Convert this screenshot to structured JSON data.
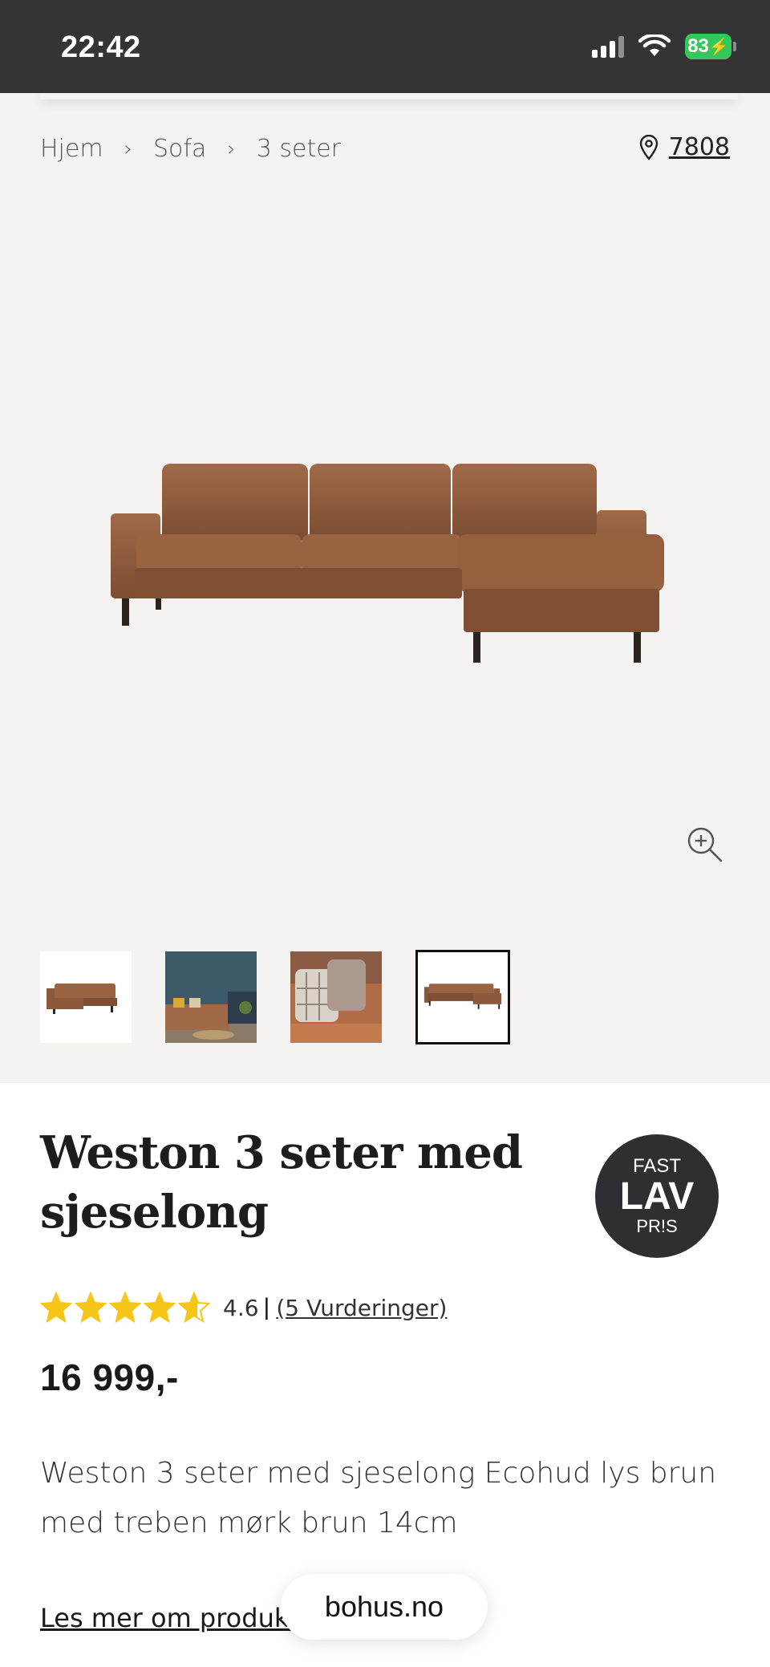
{
  "status_bar": {
    "time": "22:42",
    "battery": "83"
  },
  "breadcrumb": {
    "items": [
      "Hjem",
      "Sofa",
      "3 seter"
    ],
    "separator": "›"
  },
  "location": {
    "icon": "location-pin-icon",
    "code": "7808"
  },
  "gallery": {
    "zoom_icon": "zoom-in-icon",
    "thumbnail_count": 4,
    "active_thumbnail": 4
  },
  "product": {
    "title": "Weston 3 seter med sjeselong",
    "badge": {
      "line1": "FAST",
      "line2": "LAV",
      "line3": "PR!S"
    },
    "rating": {
      "value": "4.6",
      "stars": 4.6,
      "max": 5,
      "separator": "|",
      "reviews_label": "(5 Vurderinger)"
    },
    "price": "16 999,-",
    "description": "Weston 3 seter med sjeselong Ecohud lys brun med treben mørk brun 14cm",
    "read_more": "Les mer om produkt"
  },
  "browser": {
    "url": "bohus.no"
  },
  "colors": {
    "status_bar": "#343436",
    "gallery_bg": "#f5f3f1",
    "badge_bg": "#2f2f31",
    "star": "#f5c518",
    "battery": "#34c759",
    "sofa": "#8b5a3c"
  }
}
